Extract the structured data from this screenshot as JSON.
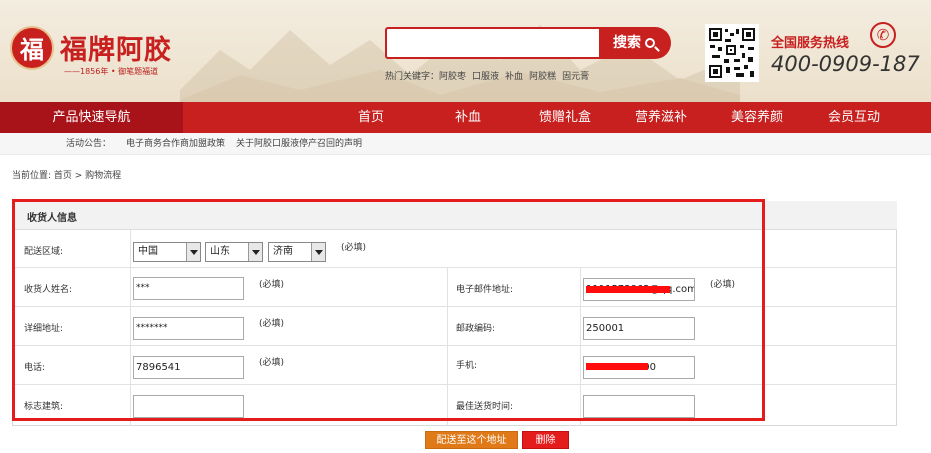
{
  "header": {
    "logo_seal": "福",
    "logo_text": "福牌阿胶",
    "logo_sub": "——1856年 • 御笔题福道",
    "search": {
      "value": "",
      "button_label": "搜索"
    },
    "hotwords_label": "热门关键字：",
    "hotwords": [
      "阿胶枣",
      "口服液",
      "补血",
      "阿胶糕",
      "固元膏"
    ],
    "hotline_label": "全国服务热线",
    "hotline_number": "400-0909-187",
    "icons": {
      "search": "search-icon",
      "phone": "phone-icon",
      "qr": "qr-code-icon"
    }
  },
  "nav": {
    "quick": "产品快速导航",
    "items": [
      "首页",
      "补血",
      "馈赠礼盒",
      "营养滋补",
      "美容养颜",
      "会员互动"
    ]
  },
  "notice": {
    "label": "活动公告：",
    "items": [
      "电子商务合作商加盟政策",
      "关于阿胶口服液停产召回的声明"
    ]
  },
  "breadcrumb": "当前位置: 首页 > 购物流程",
  "form": {
    "title": "收货人信息",
    "region_label": "配送区域:",
    "country": "中国",
    "province": "山东",
    "city": "济南",
    "required": "(必填)",
    "name_label": "收货人姓名:",
    "name_value": "***",
    "email_label": "电子邮件地址:",
    "email_value": "1111573862@qq.com",
    "address_label": "详细地址:",
    "address_value": "*******",
    "zip_label": "邮政编码:",
    "zip_value": "250001",
    "phone_label": "电话:",
    "phone_value": "7896541",
    "mobile_label": "手机:",
    "mobile_value": "13800000000",
    "landmark_label": "标志建筑:",
    "landmark_value": "",
    "delivery_time_label": "最佳送货时间:",
    "delivery_time_value": ""
  },
  "actions": {
    "ship_label": "配送至这个地址",
    "delete_label": "删除"
  },
  "colors": {
    "brand_red": "#c81f1f",
    "highlight": "#e41c1c",
    "ship_button": "#e07a18"
  }
}
